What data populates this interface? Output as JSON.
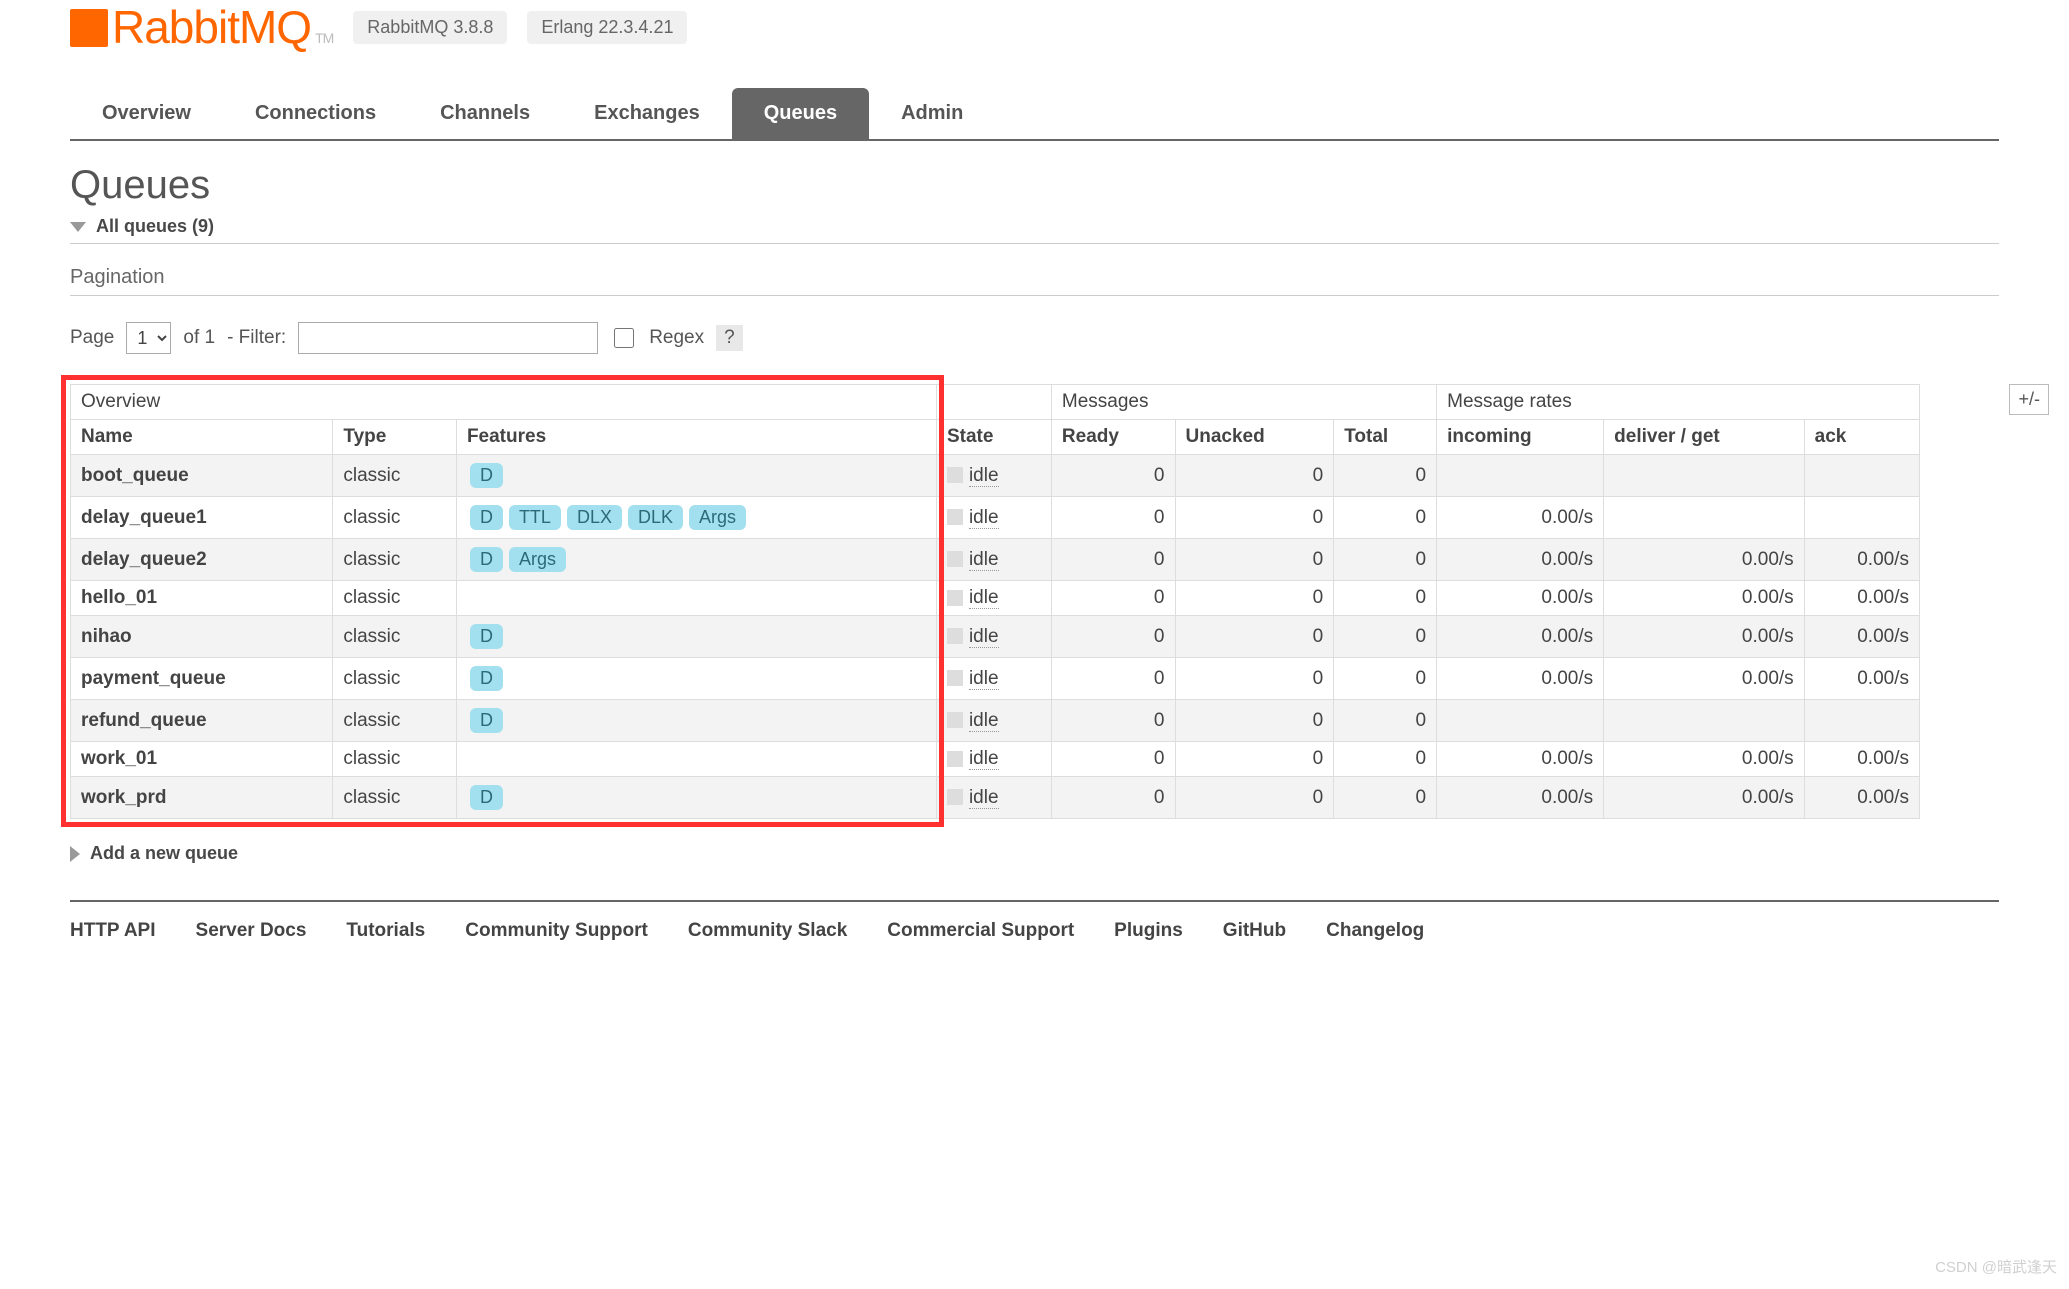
{
  "header": {
    "logo_text": "RabbitMQ",
    "tm": "TM",
    "rabbitmq_version": "RabbitMQ 3.8.8",
    "erlang_version": "Erlang 22.3.4.21"
  },
  "tabs": [
    "Overview",
    "Connections",
    "Channels",
    "Exchanges",
    "Queues",
    "Admin"
  ],
  "active_tab_index": 4,
  "page_title": "Queues",
  "all_queues_label": "All queues (9)",
  "pagination_label": "Pagination",
  "pager": {
    "page_label": "Page",
    "page_value": "1",
    "of_label": "of 1",
    "filter_label": "- Filter:",
    "filter_value": "",
    "regex_label": "Regex",
    "help": "?"
  },
  "table": {
    "group_headers": [
      "Overview",
      "",
      "Messages",
      "Message rates"
    ],
    "sub_headers": [
      "Name",
      "Type",
      "Features",
      "State",
      "Ready",
      "Unacked",
      "Total",
      "incoming",
      "deliver / get",
      "ack"
    ],
    "plus_minus": "+/-",
    "rows": [
      {
        "name": "boot_queue",
        "type": "classic",
        "features": [
          "D"
        ],
        "state": "idle",
        "ready": "0",
        "unacked": "0",
        "total": "0",
        "incoming": "",
        "deliver": "",
        "ack": ""
      },
      {
        "name": "delay_queue1",
        "type": "classic",
        "features": [
          "D",
          "TTL",
          "DLX",
          "DLK",
          "Args"
        ],
        "state": "idle",
        "ready": "0",
        "unacked": "0",
        "total": "0",
        "incoming": "0.00/s",
        "deliver": "",
        "ack": ""
      },
      {
        "name": "delay_queue2",
        "type": "classic",
        "features": [
          "D",
          "Args"
        ],
        "state": "idle",
        "ready": "0",
        "unacked": "0",
        "total": "0",
        "incoming": "0.00/s",
        "deliver": "0.00/s",
        "ack": "0.00/s"
      },
      {
        "name": "hello_01",
        "type": "classic",
        "features": [],
        "state": "idle",
        "ready": "0",
        "unacked": "0",
        "total": "0",
        "incoming": "0.00/s",
        "deliver": "0.00/s",
        "ack": "0.00/s"
      },
      {
        "name": "nihao",
        "type": "classic",
        "features": [
          "D"
        ],
        "state": "idle",
        "ready": "0",
        "unacked": "0",
        "total": "0",
        "incoming": "0.00/s",
        "deliver": "0.00/s",
        "ack": "0.00/s"
      },
      {
        "name": "payment_queue",
        "type": "classic",
        "features": [
          "D"
        ],
        "state": "idle",
        "ready": "0",
        "unacked": "0",
        "total": "0",
        "incoming": "0.00/s",
        "deliver": "0.00/s",
        "ack": "0.00/s"
      },
      {
        "name": "refund_queue",
        "type": "classic",
        "features": [
          "D"
        ],
        "state": "idle",
        "ready": "0",
        "unacked": "0",
        "total": "0",
        "incoming": "",
        "deliver": "",
        "ack": ""
      },
      {
        "name": "work_01",
        "type": "classic",
        "features": [],
        "state": "idle",
        "ready": "0",
        "unacked": "0",
        "total": "0",
        "incoming": "0.00/s",
        "deliver": "0.00/s",
        "ack": "0.00/s"
      },
      {
        "name": "work_prd",
        "type": "classic",
        "features": [
          "D"
        ],
        "state": "idle",
        "ready": "0",
        "unacked": "0",
        "total": "0",
        "incoming": "0.00/s",
        "deliver": "0.00/s",
        "ack": "0.00/s"
      }
    ]
  },
  "add_queue_label": "Add a new queue",
  "footer_links": [
    "HTTP API",
    "Server Docs",
    "Tutorials",
    "Community Support",
    "Community Slack",
    "Commercial Support",
    "Plugins",
    "GitHub",
    "Changelog"
  ],
  "watermark": "CSDN @暗武逢天"
}
